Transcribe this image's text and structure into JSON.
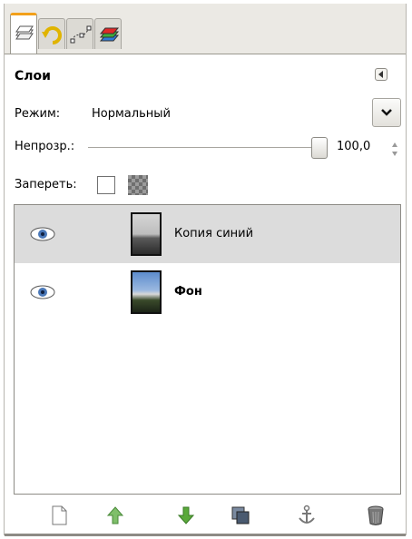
{
  "tabs": [
    {
      "name": "layers-tab-icon"
    },
    {
      "name": "undo-history-tab-icon"
    },
    {
      "name": "paths-tab-icon"
    },
    {
      "name": "channels-tab-icon"
    }
  ],
  "panel": {
    "title": "Слои",
    "mode_label": "Режим:",
    "mode_value": "Нормальный",
    "opacity_label": "Непрозр.:",
    "opacity_value": "100,0",
    "opacity": 1.0,
    "lock_label": "Запереть:"
  },
  "layers": [
    {
      "name": "Копия синий",
      "visible": true,
      "selected": true,
      "bold": false
    },
    {
      "name": "Фон",
      "visible": true,
      "selected": false,
      "bold": true
    }
  ],
  "bottom_buttons": [
    {
      "name": "new-layer-button",
      "icon": "new-page-icon"
    },
    {
      "name": "raise-layer-button",
      "icon": "arrow-up-icon"
    },
    {
      "name": "lower-layer-button",
      "icon": "arrow-down-icon"
    },
    {
      "name": "duplicate-layer-button",
      "icon": "duplicate-icon"
    },
    {
      "name": "anchor-layer-button",
      "icon": "anchor-icon"
    },
    {
      "name": "delete-layer-button",
      "icon": "trash-icon"
    }
  ],
  "colors": {
    "accent": "#f2a01a",
    "selection": "#dcdcdc",
    "arrow_green": "#5aa93a"
  }
}
